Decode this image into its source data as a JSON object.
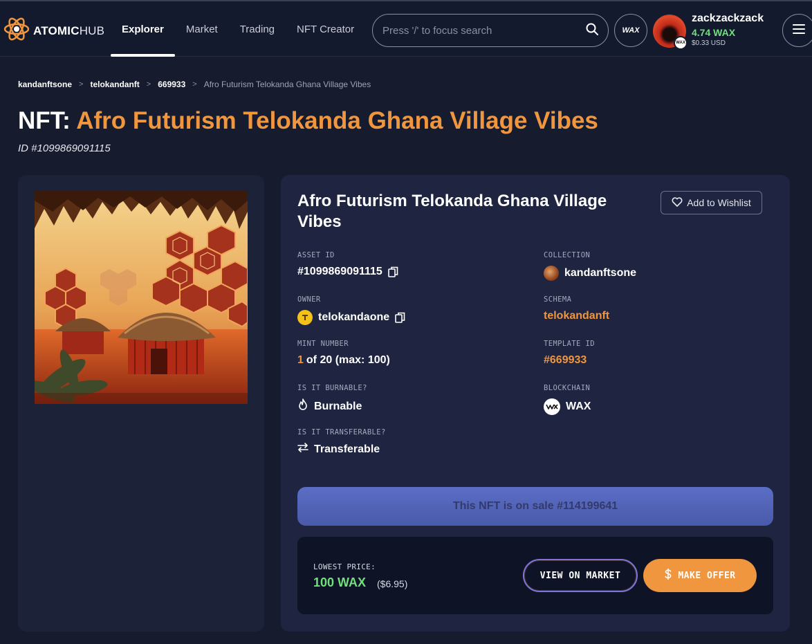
{
  "header": {
    "logo": {
      "bold": "ATOMIC",
      "light": "HUB"
    },
    "nav": [
      {
        "label": "Explorer",
        "active": true
      },
      {
        "label": "Market",
        "active": false
      },
      {
        "label": "Trading",
        "active": false
      },
      {
        "label": "NFT Creator",
        "active": false
      }
    ],
    "search": {
      "placeholder": "Press '/' to focus search"
    },
    "wax_button": "WAX",
    "account": {
      "username": "zackzackzack",
      "balance": "4.74 WAX",
      "balance_usd": "$0.33 USD",
      "badge": "WAX"
    }
  },
  "breadcrumb": [
    {
      "label": "kandanftsone"
    },
    {
      "label": "telokandanft"
    },
    {
      "label": "669933"
    },
    {
      "label": "Afro Futurism Telokanda Ghana Village Vibes"
    }
  ],
  "breadcrumb_separator": ">",
  "title": {
    "prefix": "NFT:",
    "name": "Afro Futurism Telokanda Ghana Village Vibes",
    "id": "ID #1099869091115"
  },
  "details": {
    "name": "Afro Futurism Telokanda Ghana Village Vibes",
    "wishlist_label": "Add to Wishlist",
    "asset_id": {
      "label": "ASSET ID",
      "value": "#1099869091115"
    },
    "collection": {
      "label": "COLLECTION",
      "value": "kandanftsone"
    },
    "owner": {
      "label": "OWNER",
      "value": "telokandaone"
    },
    "schema": {
      "label": "SCHEMA",
      "value": "telokandanft"
    },
    "mint": {
      "label": "MINT NUMBER",
      "number": "1",
      "rest": "of 20 (max: 100)"
    },
    "template": {
      "label": "TEMPLATE ID",
      "value": "#669933"
    },
    "burnable": {
      "label": "IS IT BURNABLE?",
      "value": "Burnable"
    },
    "blockchain": {
      "label": "BLOCKCHAIN",
      "value": "WAX"
    },
    "transferable": {
      "label": "IS IT TRANSFERABLE?",
      "value": "Transferable"
    }
  },
  "sale": {
    "banner": "This NFT is on sale #114199641",
    "lowest_price_label": "LOWEST PRICE:",
    "price_wax": "100 WAX",
    "price_usd": "($6.95)",
    "view_market": "VIEW ON MARKET",
    "make_offer": "MAKE OFFER"
  },
  "colors": {
    "accent": "#f0963e",
    "positive": "#6fe17b",
    "background": "#161b2e",
    "card": "#1f2540",
    "sale_banner": "#5b6ec6"
  },
  "icons": [
    "atom-logo-icon",
    "search-icon",
    "wax-logo-icon",
    "menu-icon",
    "heart-icon",
    "copy-icon",
    "flame-icon",
    "transfer-arrows-icon",
    "dollar-icon"
  ]
}
